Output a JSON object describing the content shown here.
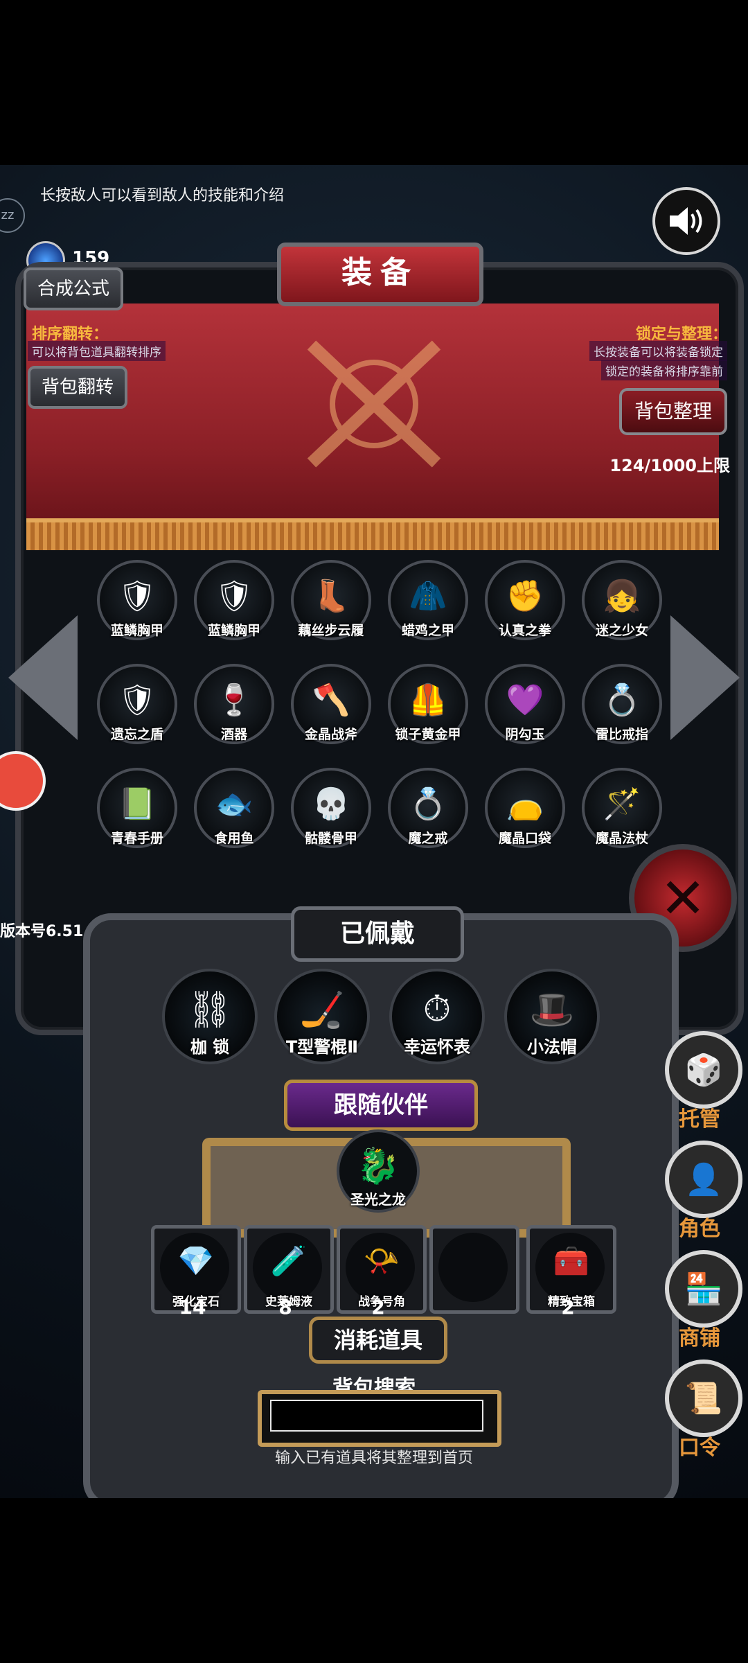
{
  "hint": "长按敌人可以看到敌人的技能和介绍",
  "zz_label": "zz",
  "gem_count": "159",
  "panel": {
    "title": "装备",
    "craft_button": "合成公式",
    "sort": {
      "title": "排序翻转：",
      "note": "可以将背包道具翻转排序",
      "button": "背包翻转"
    },
    "lock": {
      "title": "锁定与整理：",
      "note1": "长按装备可以将装备锁定",
      "note2": "锁定的装备将排序靠前",
      "button": "背包整理"
    },
    "capacity": "124/1000上限"
  },
  "items": [
    {
      "label": "蓝鳞胸甲",
      "icon": "armor-icon",
      "glyph": "🛡"
    },
    {
      "label": "蓝鳞胸甲",
      "icon": "armor-icon",
      "glyph": "🛡"
    },
    {
      "label": "藕丝步云履",
      "icon": "boots-icon",
      "glyph": "👢"
    },
    {
      "label": "蜡鸡之甲",
      "icon": "robe-icon",
      "glyph": "🧥"
    },
    {
      "label": "认真之拳",
      "icon": "fist-icon",
      "glyph": "✊"
    },
    {
      "label": "迷之少女",
      "icon": "girl-icon",
      "glyph": "👧"
    },
    {
      "label": "遗忘之盾",
      "icon": "shield-icon",
      "glyph": "🛡"
    },
    {
      "label": "酒器",
      "icon": "cup-icon",
      "glyph": "🍷"
    },
    {
      "label": "金晶战斧",
      "icon": "axe-icon",
      "glyph": "🪓"
    },
    {
      "label": "锁子黄金甲",
      "icon": "golden-armor-icon",
      "glyph": "🦺"
    },
    {
      "label": "阴勾玉",
      "icon": "jade-icon",
      "glyph": "💜"
    },
    {
      "label": "雷比戒指",
      "icon": "ring-icon",
      "glyph": "💍"
    },
    {
      "label": "青春手册",
      "icon": "book-icon",
      "glyph": "📗"
    },
    {
      "label": "食用鱼",
      "icon": "fish-icon",
      "glyph": "🐟"
    },
    {
      "label": "骷髅骨甲",
      "icon": "skeleton-armor-icon",
      "glyph": "💀"
    },
    {
      "label": "魔之戒",
      "icon": "ring-icon",
      "glyph": "💍"
    },
    {
      "label": "魔晶口袋",
      "icon": "pouch-icon",
      "glyph": "👝"
    },
    {
      "label": "魔晶法杖",
      "icon": "staff-icon",
      "glyph": "🪄"
    }
  ],
  "version": "版本号6.51",
  "worn": {
    "title": "已佩戴",
    "slots": [
      {
        "label": "枷 锁",
        "icon": "chain-icon",
        "glyph": "⛓"
      },
      {
        "label": "T型警棍Ⅱ",
        "icon": "baton-icon",
        "glyph": "🏒"
      },
      {
        "label": "幸运怀表",
        "icon": "pocket-watch-icon",
        "glyph": "⏱"
      },
      {
        "label": "小法帽",
        "icon": "wizard-hat-icon",
        "glyph": "🎩"
      }
    ]
  },
  "companion": {
    "title": "跟随伙伴",
    "slot": {
      "label": "圣光之龙",
      "icon": "dragon-icon",
      "glyph": "🐉"
    }
  },
  "consumables": {
    "title": "消耗道具",
    "slots": [
      {
        "label": "强化宝石",
        "count": "14",
        "icon": "gem-icon",
        "glyph": "💎"
      },
      {
        "label": "史莱姆液",
        "count": "8",
        "icon": "potion-icon",
        "glyph": "🧪"
      },
      {
        "label": "战争号角",
        "count": "2",
        "icon": "horn-icon",
        "glyph": "📯"
      },
      {
        "label": "",
        "count": "",
        "icon": "empty-slot",
        "glyph": ""
      },
      {
        "label": "精致宝箱",
        "count": "2",
        "icon": "chest-icon",
        "glyph": "🧰"
      }
    ]
  },
  "search": {
    "title": "背包搜索",
    "value": "",
    "hint": "输入已有道具将其整理到首页"
  },
  "side_menu": [
    {
      "label": "托管",
      "icon": "dice-icon",
      "glyph": "🎲"
    },
    {
      "label": "角色",
      "icon": "character-icon",
      "glyph": "👤"
    },
    {
      "label": "商铺",
      "icon": "shop-icon",
      "glyph": "🏪"
    },
    {
      "label": "口令",
      "icon": "scroll-icon",
      "glyph": "📜"
    }
  ]
}
